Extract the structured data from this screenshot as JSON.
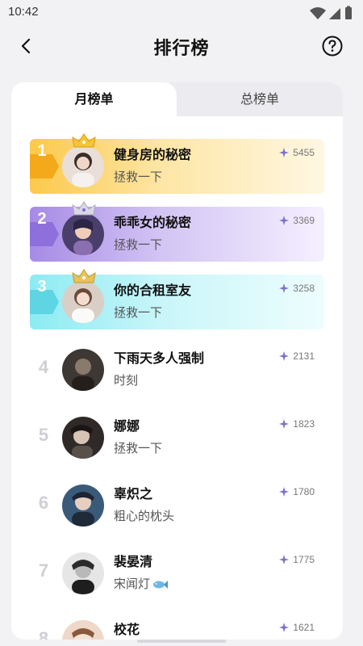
{
  "status": {
    "time": "10:42"
  },
  "header": {
    "title": "排行榜"
  },
  "tabs": [
    {
      "label": "月榜单",
      "active": true
    },
    {
      "label": "总榜单",
      "active": false
    }
  ],
  "ranking": [
    {
      "rank": "1",
      "title": "健身房的秘密",
      "subtitle": "拯救一下",
      "score": "5455",
      "color": "#f7b928"
    },
    {
      "rank": "2",
      "title": "乖乖女的秘密",
      "subtitle": "拯救一下",
      "score": "3369",
      "color": "#8e6fdc"
    },
    {
      "rank": "3",
      "title": "你的合租室友",
      "subtitle": "拯救一下",
      "score": "3258",
      "color": "#5fd4e2"
    },
    {
      "rank": "4",
      "title": "下雨天多人强制",
      "subtitle": "时刻",
      "score": "2131"
    },
    {
      "rank": "5",
      "title": "娜娜",
      "subtitle": "拯救一下",
      "score": "1823"
    },
    {
      "rank": "6",
      "title": "辜炽之",
      "subtitle": "粗心的枕头",
      "score": "1780"
    },
    {
      "rank": "7",
      "title": "裴晏清",
      "subtitle": "宋闻灯",
      "score": "1775",
      "subtitle_icon": "fish-icon"
    },
    {
      "rank": "8",
      "title": "校花",
      "subtitle": "",
      "score": "1621"
    }
  ],
  "icons": {
    "back": "back-arrow-icon",
    "help": "help-question-icon",
    "score": "sparkle-icon",
    "crown": "crown-icon"
  }
}
